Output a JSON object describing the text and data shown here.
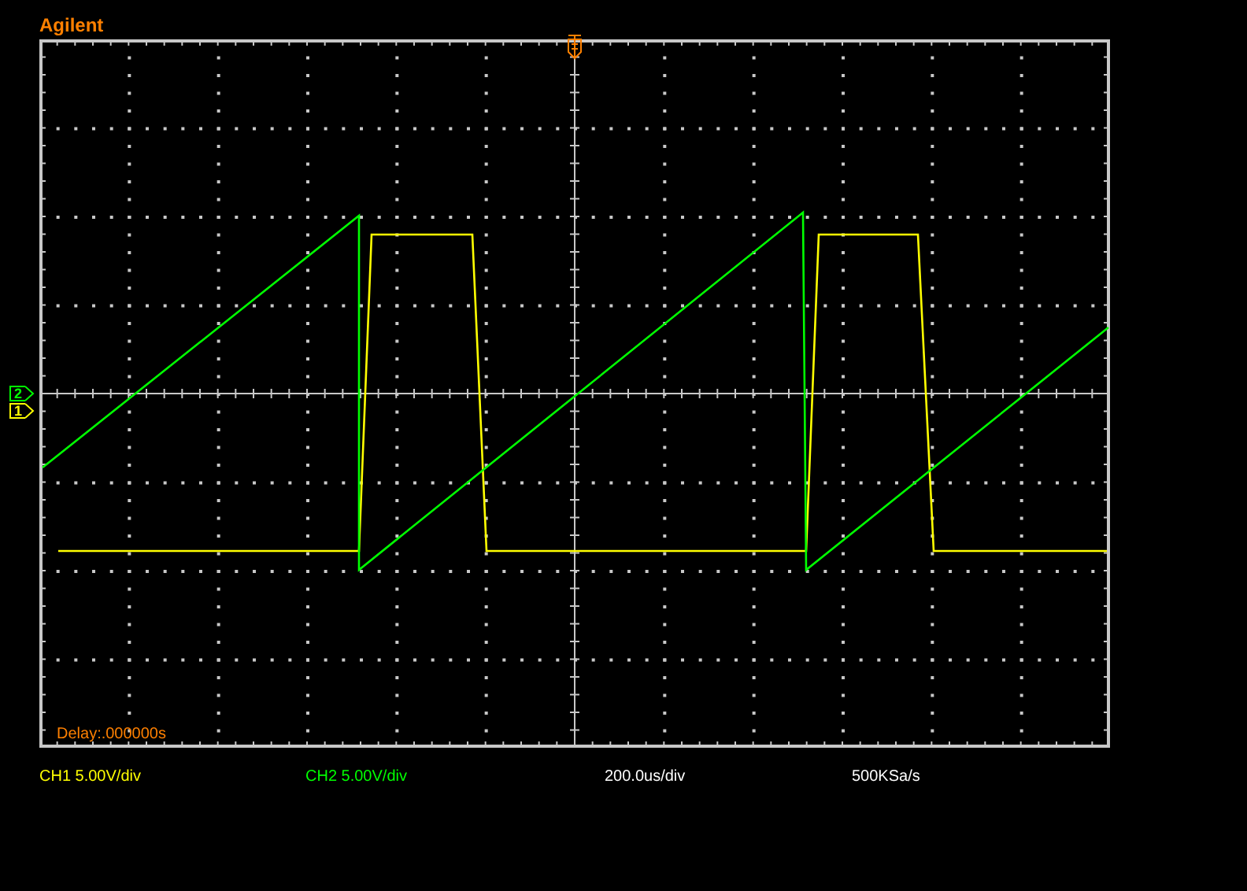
{
  "brand": "Agilent",
  "channels": [
    {
      "kind": "square",
      "color": "#ffff00",
      "scale": "CH1 5.00V/div"
    },
    {
      "kind": "sawtooth",
      "color": "#00ff00",
      "scale": "CH2 5.00V/div"
    }
  ],
  "markers": [
    {
      "label": "2",
      "color": "#00ff00"
    },
    {
      "label": "1",
      "color": "#ffff00"
    }
  ],
  "delay": "Delay:.000000s",
  "timebase": "200.0us/div",
  "sample_rate": "500KSa/s"
}
